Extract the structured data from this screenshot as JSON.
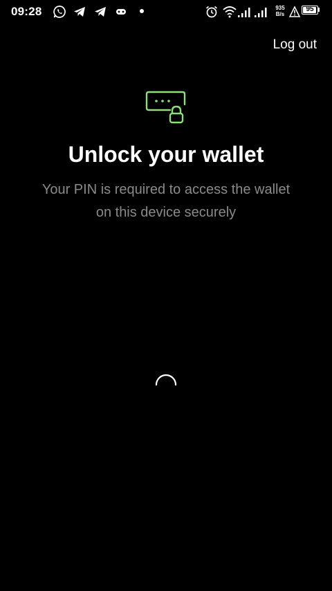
{
  "status_bar": {
    "time": "09:28",
    "net_speed_value": "935",
    "net_speed_unit": "B/s",
    "battery_level": "95",
    "battery_fraction": 0.95
  },
  "header": {
    "logout_label": "Log out"
  },
  "main": {
    "title": "Unlock your wallet",
    "subtitle": "Your PIN is required to access the wallet on this device securely",
    "icon": "pin-lock-icon",
    "loading": "spinner-icon"
  },
  "colors": {
    "background": "#000000",
    "accent_green": "#8fe07a",
    "text_primary": "#ffffff",
    "text_secondary": "#8a8a8a"
  }
}
